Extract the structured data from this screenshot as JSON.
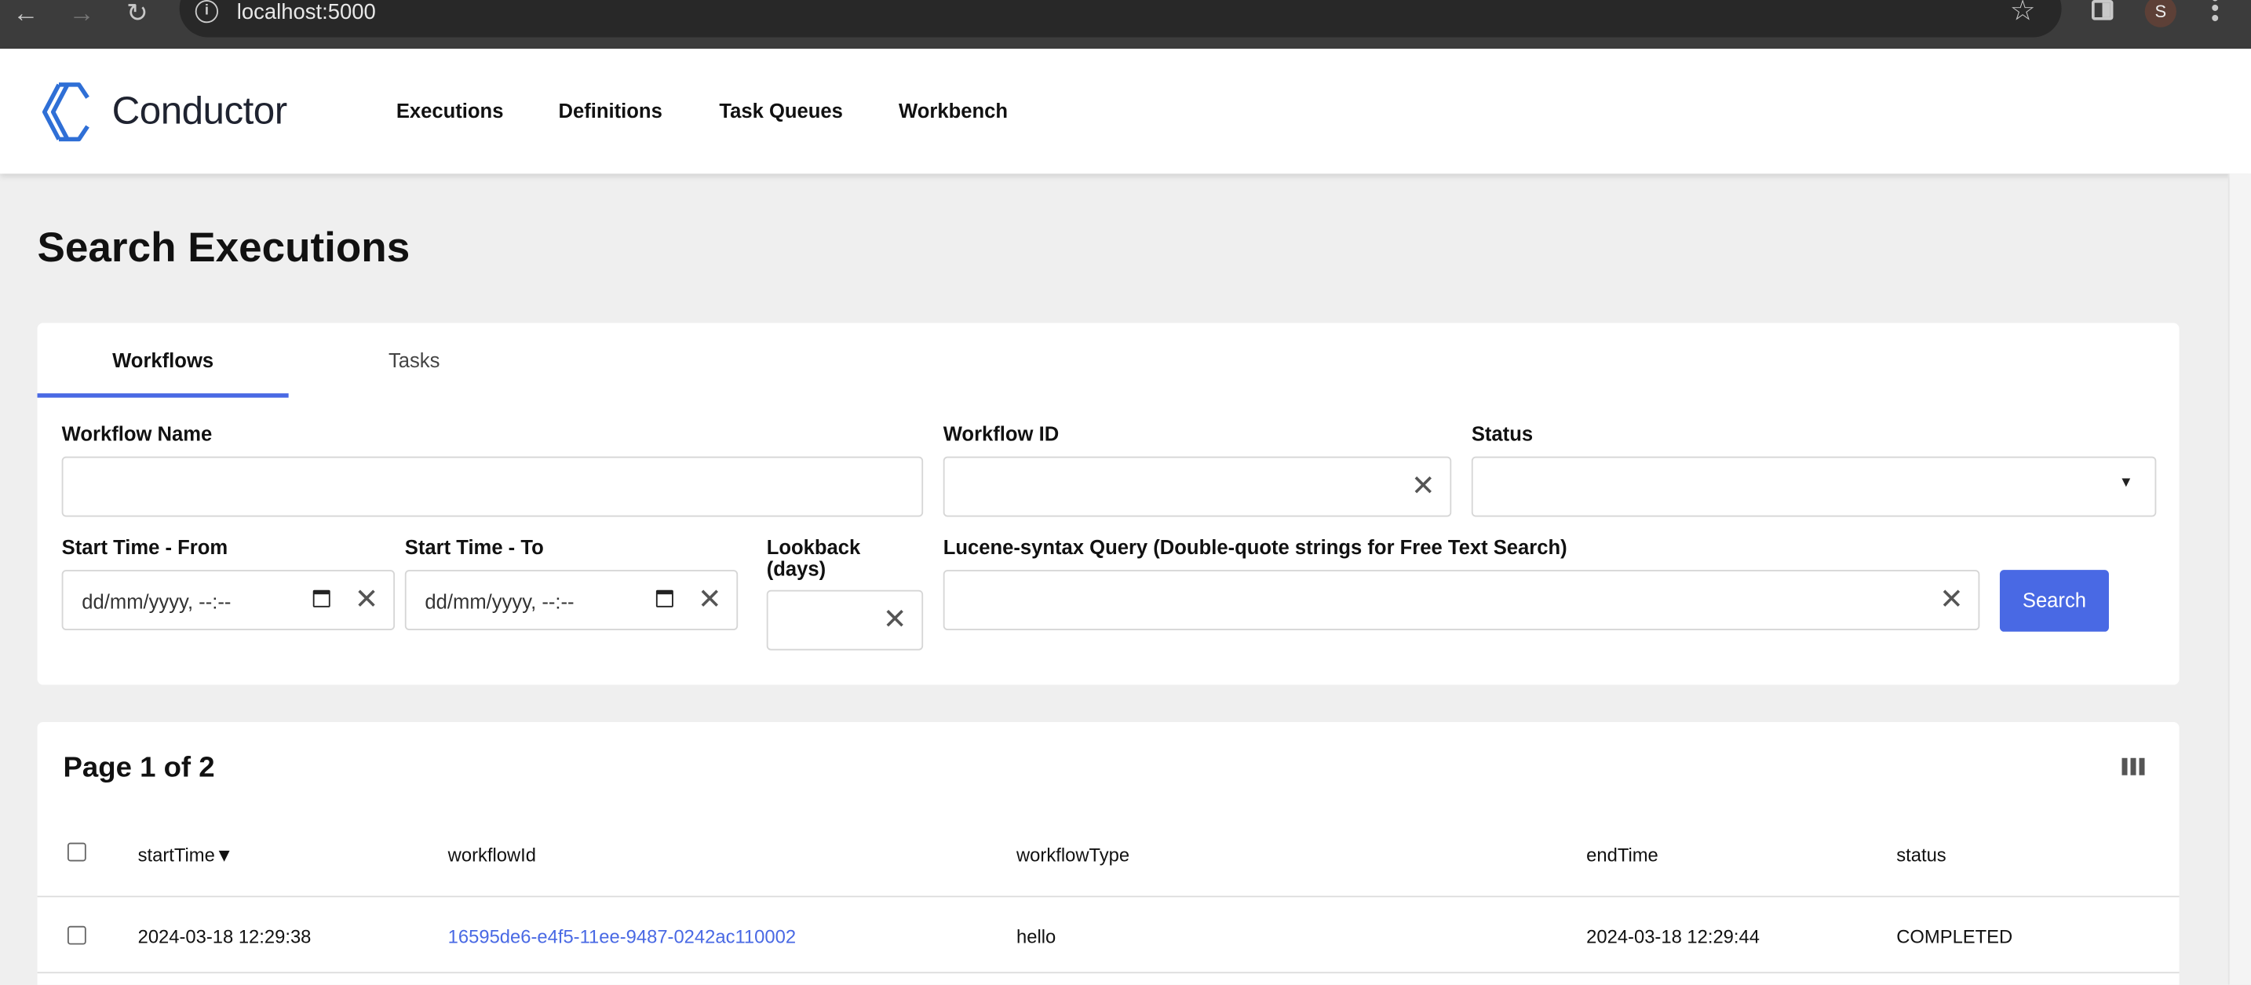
{
  "browser": {
    "url": "localhost:5000",
    "avatar_letter": "S"
  },
  "app": {
    "brand": "Conductor",
    "nav": [
      "Executions",
      "Definitions",
      "Task Queues",
      "Workbench"
    ],
    "accent": "#4969e4"
  },
  "page": {
    "title": "Search Executions"
  },
  "search": {
    "tabs": [
      {
        "label": "Workflows",
        "active": true
      },
      {
        "label": "Tasks",
        "active": false
      }
    ],
    "workflow_name": {
      "label": "Workflow Name",
      "value": ""
    },
    "workflow_id": {
      "label": "Workflow ID",
      "value": ""
    },
    "status": {
      "label": "Status",
      "value": ""
    },
    "start_from": {
      "label": "Start Time - From",
      "placeholder": "dd/mm/yyyy, --:--"
    },
    "start_to": {
      "label": "Start Time - To",
      "placeholder": "dd/mm/yyyy, --:--"
    },
    "lookback": {
      "label_line1": "Lookback",
      "label_line2": "(days)",
      "value": ""
    },
    "lucene": {
      "label": "Lucene-syntax Query (Double-quote strings for Free Text Search)",
      "value": ""
    },
    "search_button": "Search"
  },
  "results": {
    "page_info": "Page 1 of 2",
    "columns": [
      "startTime",
      "workflowId",
      "workflowType",
      "endTime",
      "status"
    ],
    "sort_indicator": "▼",
    "rows": [
      {
        "startTime": "2024-03-18 12:29:38",
        "workflowId": "16595de6-e4f5-11ee-9487-0242ac110002",
        "workflowType": "hello",
        "endTime": "2024-03-18 12:29:44",
        "status": "COMPLETED"
      }
    ]
  }
}
